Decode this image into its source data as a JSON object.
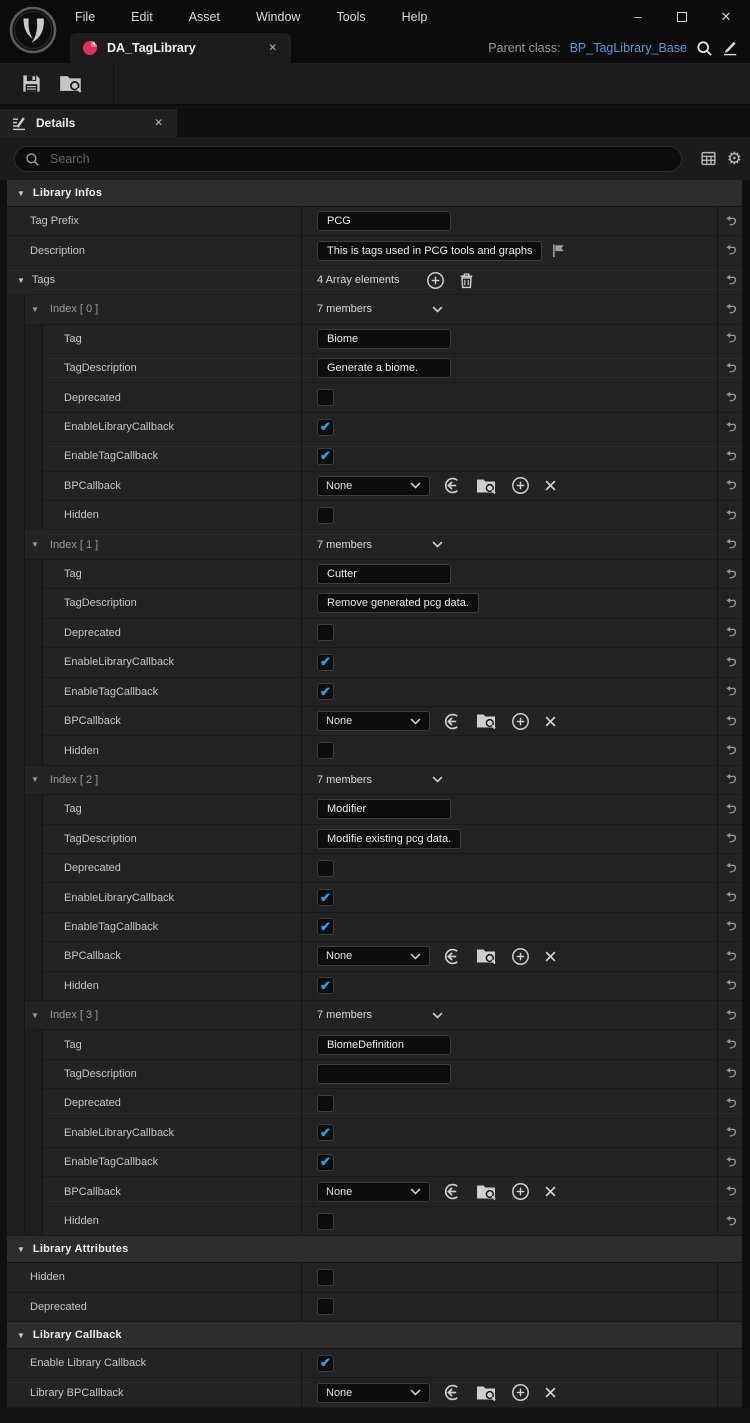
{
  "colors": {
    "accent_blue": "#2a9df4",
    "parent_class_link": "#5b9bd5",
    "asset_icon_pink": "#df2e63"
  },
  "icons": {
    "check": "✔",
    "close": "✕",
    "minimize": "–",
    "expander": "▼",
    "gear": "⚙"
  },
  "window": {
    "menu": [
      "File",
      "Edit",
      "Asset",
      "Window",
      "Tools",
      "Help"
    ]
  },
  "asset_tab": {
    "title": "DA_TagLibrary",
    "parent_class_label": "Parent class:",
    "parent_class_value": "BP_TagLibrary_Base"
  },
  "details_panel": {
    "tab_title": "Details",
    "search_placeholder": "Search"
  },
  "sections": [
    {
      "label": "Library Infos",
      "rows": [
        {
          "name": "Tag Prefix",
          "depth": 0,
          "reset": true,
          "control": {
            "type": "text",
            "value": "PCG"
          }
        },
        {
          "name": "Description",
          "depth": 0,
          "reset": true,
          "control": {
            "type": "text",
            "value": "This is tags used in PCG tools and graphs",
            "flag": true
          }
        },
        {
          "name": "Tags",
          "depth": 0,
          "expander": true,
          "reset": true,
          "control": {
            "type": "array",
            "label": "4 Array elements"
          }
        },
        {
          "name": "Index [ 0 ]",
          "depth": 1,
          "expander": true,
          "muted": true,
          "reset": true,
          "control": {
            "type": "members",
            "value": "7 members"
          }
        },
        {
          "name": "Tag",
          "depth": 2,
          "reset": true,
          "control": {
            "type": "text",
            "value": "Biome"
          }
        },
        {
          "name": "TagDescription",
          "depth": 2,
          "reset": true,
          "control": {
            "type": "text",
            "value": "Generate a biome."
          }
        },
        {
          "name": "Deprecated",
          "depth": 2,
          "reset": true,
          "control": {
            "type": "checkbox",
            "checked": false
          }
        },
        {
          "name": "EnableLibraryCallback",
          "depth": 2,
          "reset": true,
          "control": {
            "type": "checkbox",
            "checked": true
          }
        },
        {
          "name": "EnableTagCallback",
          "depth": 2,
          "reset": true,
          "control": {
            "type": "checkbox",
            "checked": true
          }
        },
        {
          "name": "BPCallback",
          "depth": 2,
          "reset": true,
          "control": {
            "type": "bpcallback",
            "value": "None"
          }
        },
        {
          "name": "Hidden",
          "depth": 2,
          "reset": true,
          "control": {
            "type": "checkbox",
            "checked": false
          }
        },
        {
          "name": "Index [ 1 ]",
          "depth": 1,
          "expander": true,
          "muted": true,
          "reset": true,
          "control": {
            "type": "members",
            "value": "7 members"
          }
        },
        {
          "name": "Tag",
          "depth": 2,
          "reset": true,
          "control": {
            "type": "text",
            "value": "Cutter"
          }
        },
        {
          "name": "TagDescription",
          "depth": 2,
          "reset": true,
          "control": {
            "type": "text",
            "value": "Remove generated pcg data."
          }
        },
        {
          "name": "Deprecated",
          "depth": 2,
          "reset": true,
          "control": {
            "type": "checkbox",
            "checked": false
          }
        },
        {
          "name": "EnableLibraryCallback",
          "depth": 2,
          "reset": true,
          "control": {
            "type": "checkbox",
            "checked": true
          }
        },
        {
          "name": "EnableTagCallback",
          "depth": 2,
          "reset": true,
          "control": {
            "type": "checkbox",
            "checked": true
          }
        },
        {
          "name": "BPCallback",
          "depth": 2,
          "reset": true,
          "control": {
            "type": "bpcallback",
            "value": "None"
          }
        },
        {
          "name": "Hidden",
          "depth": 2,
          "reset": true,
          "control": {
            "type": "checkbox",
            "checked": false
          }
        },
        {
          "name": "Index [ 2 ]",
          "depth": 1,
          "expander": true,
          "muted": true,
          "reset": true,
          "control": {
            "type": "members",
            "value": "7 members"
          }
        },
        {
          "name": "Tag",
          "depth": 2,
          "reset": true,
          "control": {
            "type": "text",
            "value": "Modifier"
          }
        },
        {
          "name": "TagDescription",
          "depth": 2,
          "reset": true,
          "control": {
            "type": "text",
            "value": "Modifie existing pcg data."
          }
        },
        {
          "name": "Deprecated",
          "depth": 2,
          "reset": true,
          "control": {
            "type": "checkbox",
            "checked": false
          }
        },
        {
          "name": "EnableLibraryCallback",
          "depth": 2,
          "reset": true,
          "control": {
            "type": "checkbox",
            "checked": true
          }
        },
        {
          "name": "EnableTagCallback",
          "depth": 2,
          "reset": true,
          "control": {
            "type": "checkbox",
            "checked": true
          }
        },
        {
          "name": "BPCallback",
          "depth": 2,
          "reset": true,
          "control": {
            "type": "bpcallback",
            "value": "None"
          }
        },
        {
          "name": "Hidden",
          "depth": 2,
          "reset": true,
          "control": {
            "type": "checkbox",
            "checked": true
          }
        },
        {
          "name": "Index [ 3 ]",
          "depth": 1,
          "expander": true,
          "muted": true,
          "reset": true,
          "control": {
            "type": "members",
            "value": "7 members"
          }
        },
        {
          "name": "Tag",
          "depth": 2,
          "reset": true,
          "control": {
            "type": "text",
            "value": "BiomeDefinition"
          }
        },
        {
          "name": "TagDescription",
          "depth": 2,
          "reset": true,
          "control": {
            "type": "text",
            "value": ""
          }
        },
        {
          "name": "Deprecated",
          "depth": 2,
          "reset": true,
          "control": {
            "type": "checkbox",
            "checked": false
          }
        },
        {
          "name": "EnableLibraryCallback",
          "depth": 2,
          "reset": true,
          "control": {
            "type": "checkbox",
            "checked": true
          }
        },
        {
          "name": "EnableTagCallback",
          "depth": 2,
          "reset": true,
          "control": {
            "type": "checkbox",
            "checked": true
          }
        },
        {
          "name": "BPCallback",
          "depth": 2,
          "reset": true,
          "control": {
            "type": "bpcallback",
            "value": "None"
          }
        },
        {
          "name": "Hidden",
          "depth": 2,
          "reset": true,
          "control": {
            "type": "checkbox",
            "checked": false
          }
        }
      ]
    },
    {
      "label": "Library Attributes",
      "rows": [
        {
          "name": "Hidden",
          "depth": 0,
          "reset": false,
          "control": {
            "type": "checkbox",
            "checked": false
          }
        },
        {
          "name": "Deprecated",
          "depth": 0,
          "reset": false,
          "control": {
            "type": "checkbox",
            "checked": false
          }
        }
      ]
    },
    {
      "label": "Library Callback",
      "rows": [
        {
          "name": "Enable Library Callback",
          "depth": 0,
          "reset": false,
          "control": {
            "type": "checkbox",
            "checked": true
          }
        },
        {
          "name": "Library BPCallback",
          "depth": 0,
          "reset": false,
          "control": {
            "type": "bpcallback",
            "value": "None"
          }
        }
      ]
    }
  ]
}
